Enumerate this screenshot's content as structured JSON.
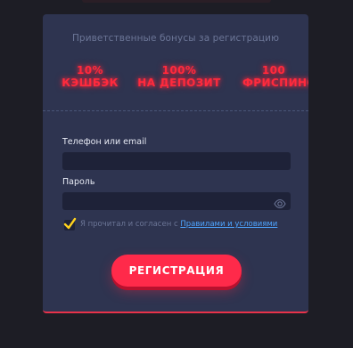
{
  "bonus": {
    "title": "Приветственные бонусы за регистрацию",
    "items": [
      {
        "line1": "10%",
        "line2": "КЭШБЭК"
      },
      {
        "line1": "100%",
        "line2": "НА ДЕПОЗИТ"
      },
      {
        "line1": "100",
        "line2": "ФРИСПИНОВ"
      }
    ]
  },
  "form": {
    "login_label": "Телефон или email",
    "login_value": "",
    "password_label": "Пароль",
    "password_value": "",
    "agree_text": "Я прочитал и согласен с ",
    "agree_link": "Правилами и условиями",
    "agree_checked": true,
    "submit_label": "РЕГИСТРАЦИЯ"
  },
  "colors": {
    "accent": "#ff2a4a",
    "neon_text": "#ff2a3d",
    "panel": "#2e3450",
    "field": "#1e2238",
    "checkmark": "#ffd21e",
    "link": "#4ea4ff"
  },
  "icons": {
    "password_toggle": "eye-icon",
    "checkbox_mark": "checkmark-icon"
  }
}
